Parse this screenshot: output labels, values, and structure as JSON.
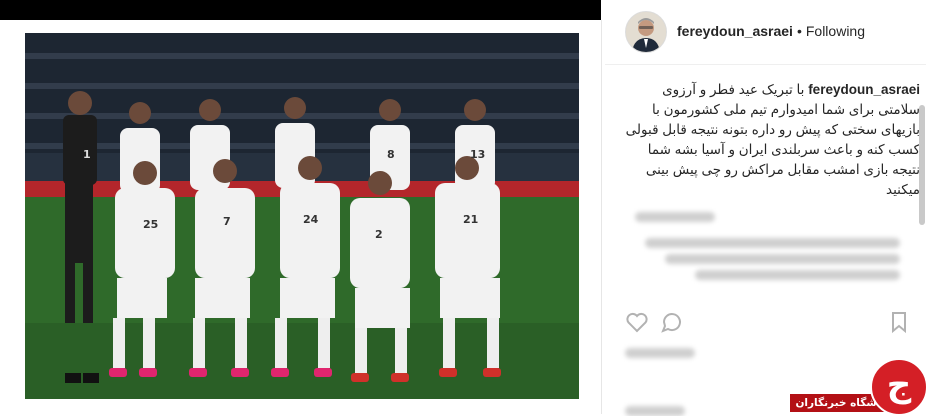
{
  "profile": {
    "username": "fereydoun_asraei",
    "follow_status": "Following",
    "separator": "•"
  },
  "caption": {
    "username": "fereydoun_asraei",
    "text": "با تبریک عید فطر و آرزوی سلامتی برای شما امیدوارم تیم ملی کشورمون با بازیهای سختی که پیش رو داره بتونه نتیجه قابل قبولی کسب کنه و باعث سربلندی ایران و آسیا بشه شما نتیجه بازی امشب مقابل مراکش رو چی پیش بینی میکنید"
  },
  "photo": {
    "jersey_numbers": [
      "1",
      "25",
      "7",
      "24",
      "2",
      "21",
      "8",
      "13"
    ]
  },
  "watermark": {
    "logo_letter": "ج",
    "label": "باشگاه خبرنگاران"
  },
  "colors": {
    "pitch": "#2f6a2a",
    "kit": "#f2f2f2",
    "gk_kit": "#1c1c1c",
    "watermark_red": "#d41f26"
  }
}
